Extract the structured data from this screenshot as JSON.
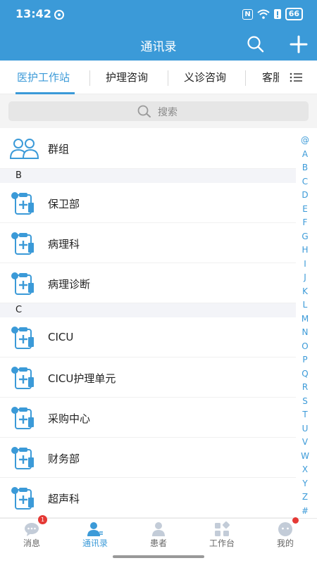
{
  "status": {
    "time": "13:42",
    "battery": "66",
    "nfc": "N"
  },
  "header": {
    "title": "通讯录"
  },
  "tabs": [
    {
      "label": "医护工作站",
      "active": true
    },
    {
      "label": "护理咨询",
      "active": false
    },
    {
      "label": "义诊咨询",
      "active": false
    },
    {
      "label": "客服",
      "active": false
    }
  ],
  "search": {
    "placeholder": "搜索"
  },
  "group": {
    "label": "群组"
  },
  "sections": [
    {
      "letter": "B",
      "items": [
        "保卫部",
        "病理科",
        "病理诊断"
      ]
    },
    {
      "letter": "C",
      "items": [
        "CICU",
        "CICU护理单元",
        "采购中心",
        "财务部",
        "超声科"
      ]
    }
  ],
  "index_letters": [
    "@",
    "A",
    "B",
    "C",
    "D",
    "E",
    "F",
    "G",
    "H",
    "I",
    "J",
    "K",
    "L",
    "M",
    "N",
    "O",
    "P",
    "Q",
    "R",
    "S",
    "T",
    "U",
    "V",
    "W",
    "X",
    "Y",
    "Z",
    "#"
  ],
  "nav": [
    {
      "label": "消息",
      "badge": "1"
    },
    {
      "label": "通讯录",
      "active": true
    },
    {
      "label": "患者"
    },
    {
      "label": "工作台"
    },
    {
      "label": "我的",
      "dot": true
    }
  ],
  "colors": {
    "primary": "#3b9ad8",
    "badge": "#e53935"
  }
}
